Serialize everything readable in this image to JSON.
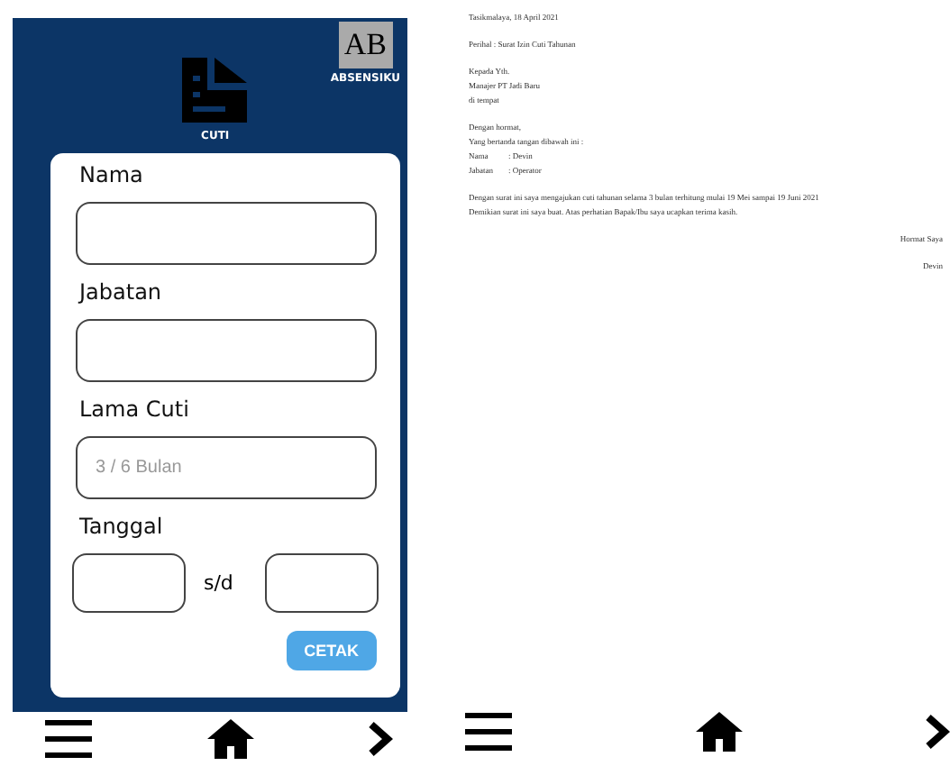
{
  "app": {
    "brand": "ABSENSIKU",
    "logo_text": "AB",
    "page_label": "CUTI"
  },
  "form": {
    "fields": [
      {
        "label": "Nama"
      },
      {
        "label": "Jabatan"
      },
      {
        "label": "Lama Cuti",
        "placeholder": "3 / 6 Bulan"
      }
    ],
    "date_label": "Tanggal",
    "date_separator": "s/d",
    "submit": "CETAK"
  },
  "letter": {
    "lines": [
      {
        "kind": "text",
        "text": "Tasikmalaya, 18 April 2021"
      },
      {
        "kind": "gap"
      },
      {
        "kind": "text",
        "text": "Perihal : Surat Izin Cuti Tahunan"
      },
      {
        "kind": "gap"
      },
      {
        "kind": "text",
        "text": "Kepada Yth."
      },
      {
        "kind": "text",
        "text": "Manajer PT Jadi Baru"
      },
      {
        "kind": "text",
        "text": "di tempat"
      },
      {
        "kind": "gap"
      },
      {
        "kind": "text",
        "text": "Dengan hormat,"
      },
      {
        "kind": "text",
        "text": "Yang bertanda tangan dibawah ini :"
      },
      {
        "kind": "pair",
        "key": "Nama",
        "value": ": Devin"
      },
      {
        "kind": "pair",
        "key": "Jabatan",
        "value": ": Operator"
      },
      {
        "kind": "gap"
      },
      {
        "kind": "text",
        "text": "Dengan surat ini saya mengajukan cuti tahunan selama 3 bulan terhitung mulai 19 Mei sampai 19 Juni 2021"
      },
      {
        "kind": "text",
        "text": "Demikian surat ini saya buat. Atas perhatian Bapak/Ibu saya ucapkan terima kasih."
      },
      {
        "kind": "gap"
      },
      {
        "kind": "right",
        "text": "Hormat Saya"
      },
      {
        "kind": "gap"
      },
      {
        "kind": "right",
        "text": "Devin"
      }
    ]
  }
}
